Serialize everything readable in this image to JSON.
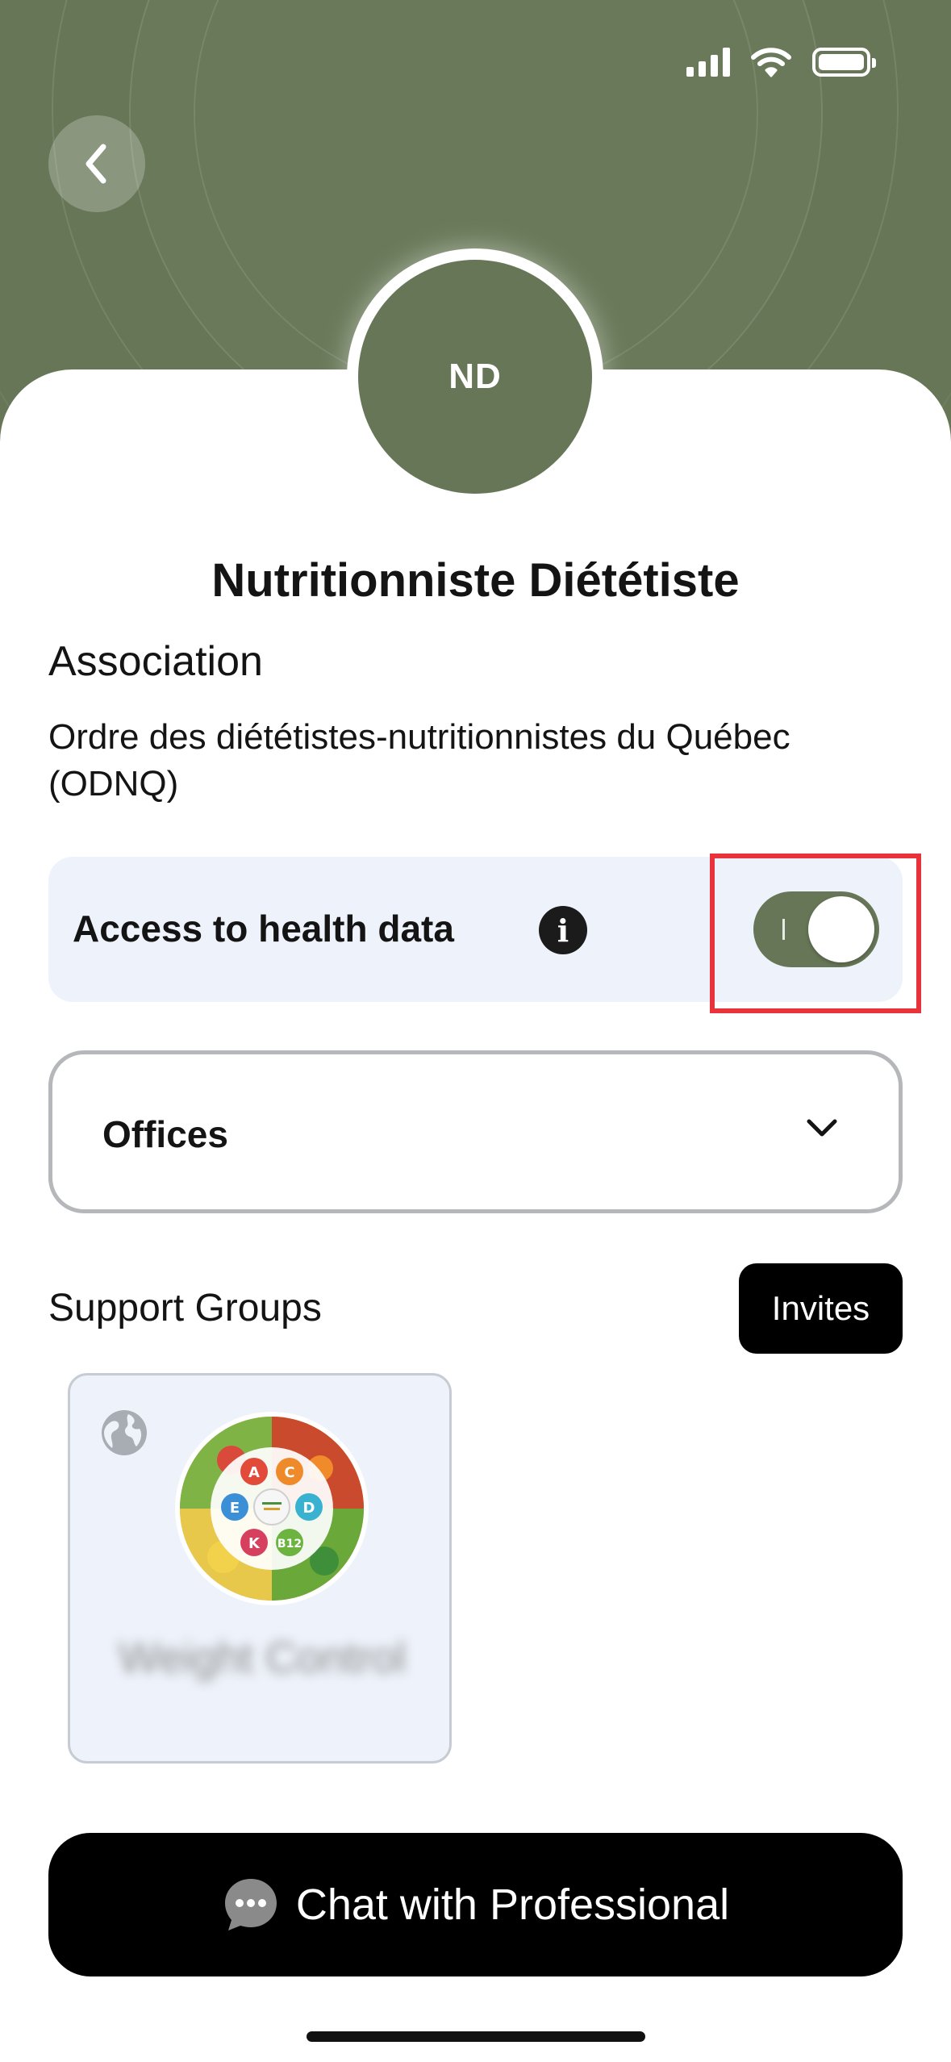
{
  "status_bar": {
    "signal_icon": "cellular-signal-icon",
    "wifi_icon": "wifi-icon",
    "battery_icon": "battery-icon",
    "battery_level": 1.0
  },
  "header": {
    "back_icon": "chevron-left-icon",
    "avatar_initials": "ND",
    "background_color": "#667656"
  },
  "profile": {
    "title": "Nutritionniste Diététiste",
    "association_label": "Association",
    "association_value": "Ordre des diététistes-nutritionnistes du Québec (ODNQ)"
  },
  "health_access": {
    "label": "Access to health data",
    "info_icon": "info-icon",
    "toggle_on": true,
    "highlight_color": "#e8323c"
  },
  "offices": {
    "label": "Offices",
    "chevron_icon": "chevron-down-icon"
  },
  "support_groups": {
    "label": "Support Groups",
    "invites_label": "Invites",
    "groups": [
      {
        "name": "Weight Control",
        "visibility_icon": "globe-icon",
        "image_icon": "healthy-eating-vitamins-image",
        "vitamin_labels": [
          "A",
          "C",
          "E",
          "D",
          "K",
          "B12"
        ]
      }
    ]
  },
  "chat": {
    "label": "Chat with Professional",
    "icon": "chat-bubble-icon"
  },
  "colors": {
    "accent": "#667656",
    "card_background": "#eef3fb",
    "primary_button": "#000000"
  }
}
